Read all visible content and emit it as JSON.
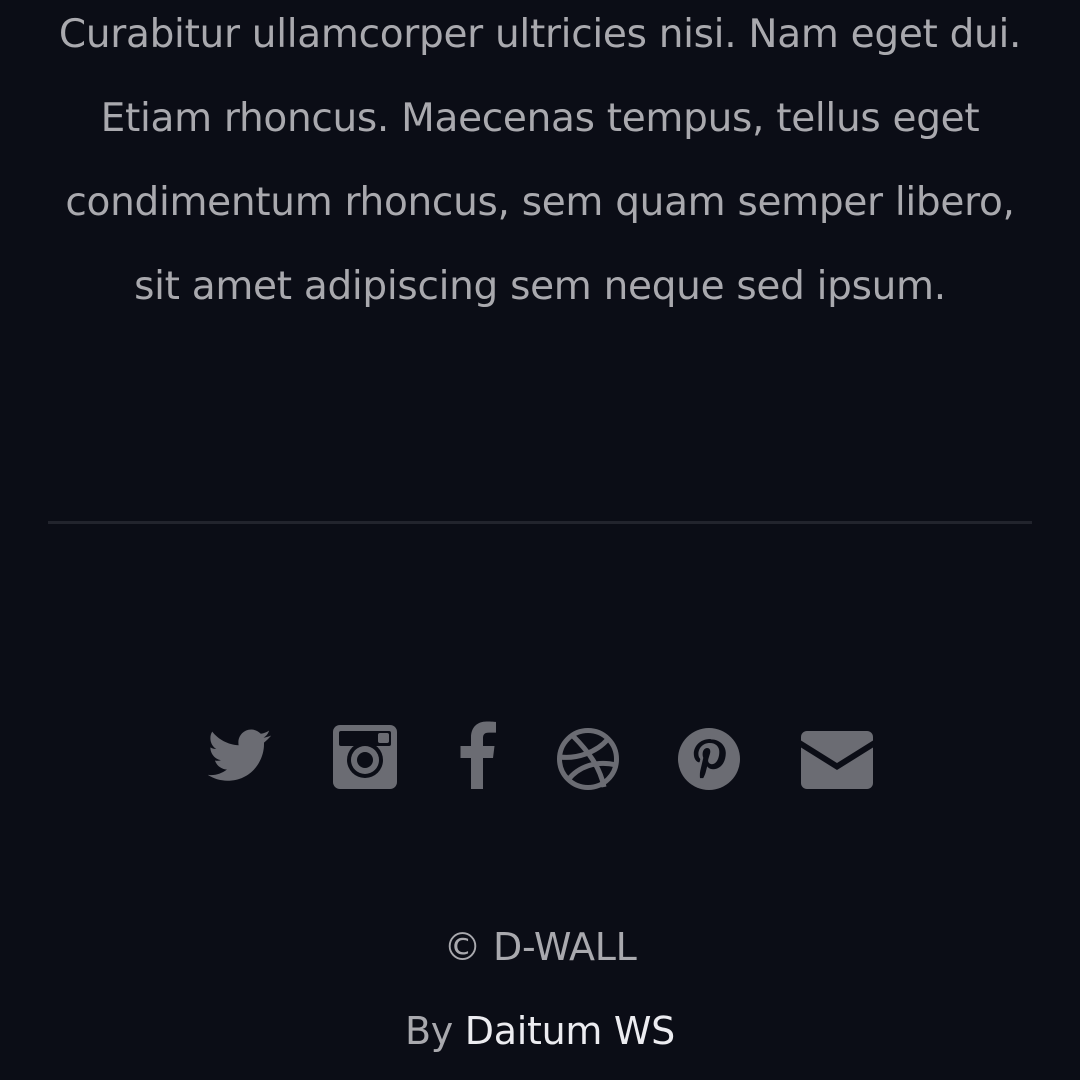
{
  "about": {
    "text": "Curabitur ullamcorper ultricies nisi. Nam eget dui. Etiam rhoncus. Maecenas tempus, tellus eget condimentum rhoncus, sem quam semper libero, sit amet adipiscing sem neque sed ipsum."
  },
  "social": {
    "icons": [
      "twitter-icon",
      "instagram-icon",
      "facebook-icon",
      "dribbble-icon",
      "pinterest-icon",
      "envelope-icon"
    ],
    "color": "#6b6c73"
  },
  "footer": {
    "copyright": "© D-WALL",
    "by_label": "By",
    "author_link": "Daitum WS"
  },
  "colors": {
    "background": "#0b0d16",
    "text": "#a9a9ae",
    "link": "#ececf0",
    "divider": "#22242d"
  }
}
